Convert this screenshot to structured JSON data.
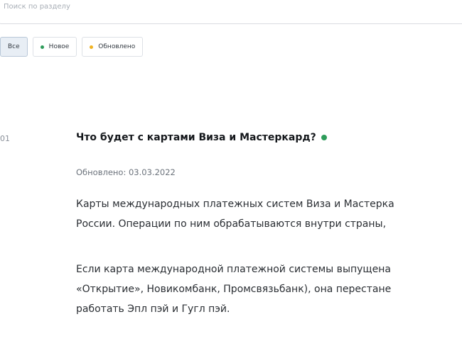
{
  "search": {
    "placeholder": "Поиск по разделу"
  },
  "filters": [
    {
      "label": "Все",
      "active": true,
      "dot_color": null
    },
    {
      "label": "Новое",
      "active": false,
      "dot_color": "#2e9c5a"
    },
    {
      "label": "Обновлено",
      "active": false,
      "dot_color": "#f0b323"
    }
  ],
  "faq": {
    "number": "01",
    "title": "Что будет с картами Виза и Мастеркард?",
    "status_color": "#2e9c5a",
    "updated": "Обновлено: 03.03.2022",
    "paragraph_1": [
      "Карты международных платежных систем Виза и Мастеркa",
      "России. Операции по ним обрабатываются внутри страны,"
    ],
    "paragraph_2": [
      "Если карта международной платежной системы выпущена",
      "«Открытие», Новикомбанк, Промсвязьбанк), она перестане",
      "работать Эпл пэй и Гугл пэй."
    ]
  }
}
